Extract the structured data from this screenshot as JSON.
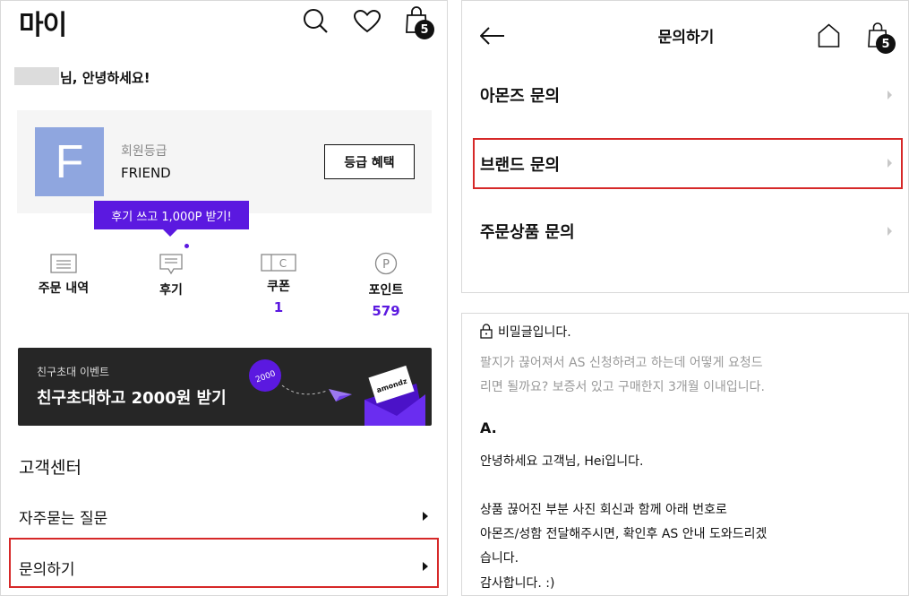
{
  "left": {
    "title": "마이",
    "cart_count": "5",
    "greeting": "님, 안녕하세요!",
    "avatar_letter": "F",
    "grade_label": "회원등급",
    "grade_value": "FRIEND",
    "benefit_button": "등급 혜택",
    "review_tooltip": "후기 쓰고 1,000P 받기!",
    "stats": [
      {
        "label": "주문 내역",
        "value": ""
      },
      {
        "label": "후기",
        "value": ""
      },
      {
        "label": "쿠폰",
        "value": "1"
      },
      {
        "label": "포인트",
        "value": "579"
      }
    ],
    "banner": {
      "subtitle": "친구초대 이벤트",
      "title": "친구초대하고 2000원 받기",
      "coin_text": "2000",
      "envelope_text": "amondz"
    },
    "customer_center": {
      "title": "고객센터",
      "items": [
        "자주묻는 질문",
        "문의하기"
      ]
    }
  },
  "right_top": {
    "header_title": "문의하기",
    "cart_count": "5",
    "items": [
      "아몬즈 문의",
      "브랜드 문의",
      "주문상품 문의"
    ]
  },
  "right_bottom": {
    "secret_label": "비밀글입니다.",
    "question_line1": "팔지가 끊어져서 AS 신청하려고 하는데 어떻게 요청드",
    "question_line2": "리면 될까요? 보증서 있고 구매한지 3개월 이내입니다.",
    "answer_title": "A.",
    "answer_lines": [
      "안녕하세요 고객님, Hei입니다.",
      "상품 끊어진 부분 사진 회신과 함께 아래 번호로",
      "아몬즈/성함 전달해주시면, 확인후 AS 안내 도와드리겠",
      "습니다.",
      "감사합니다. :)"
    ]
  },
  "colors": {
    "accent_purple": "#5b19e0",
    "highlight_red": "#d62828",
    "avatar_blue": "#8fa6df"
  }
}
